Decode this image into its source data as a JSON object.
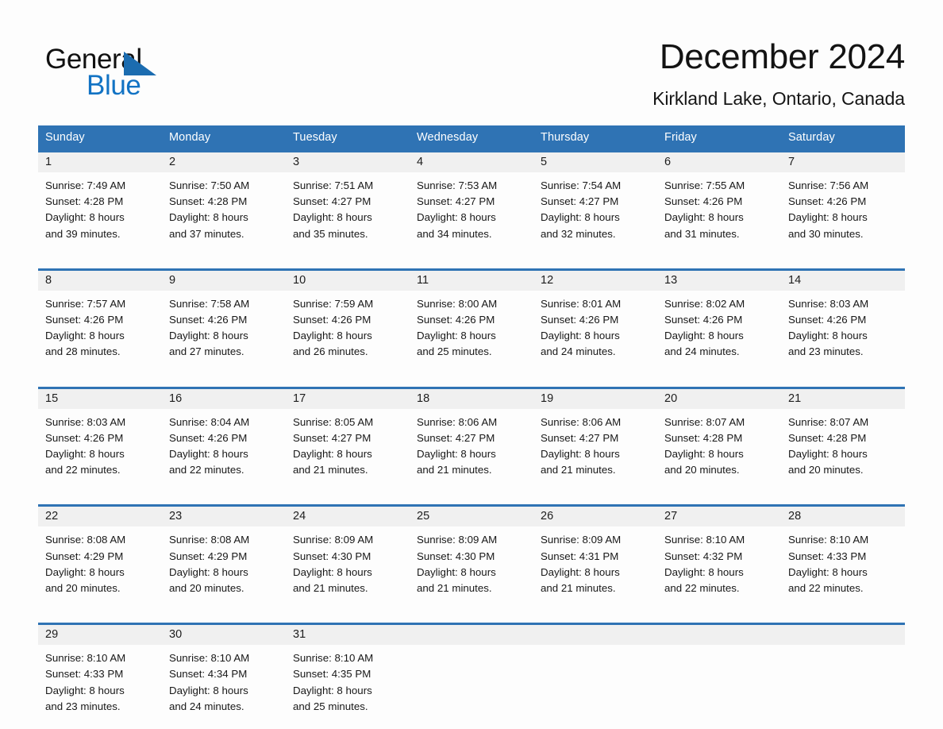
{
  "brand": {
    "name_part1": "General",
    "name_part2": "Blue",
    "triangle_color": "#1b6cb0",
    "blue_color": "#1273c4"
  },
  "header": {
    "month_title": "December 2024",
    "location": "Kirkland Lake, Ontario, Canada"
  },
  "theme": {
    "header_blue": "#2f73b4",
    "day_band_gray": "#f0f0f0",
    "page_background": "#fdfdfd"
  },
  "weekdays": [
    "Sunday",
    "Monday",
    "Tuesday",
    "Wednesday",
    "Thursday",
    "Friday",
    "Saturday"
  ],
  "weeks": [
    [
      {
        "date": "1",
        "lines": [
          "Sunrise: 7:49 AM",
          "Sunset: 4:28 PM",
          "Daylight: 8 hours",
          "and 39 minutes."
        ]
      },
      {
        "date": "2",
        "lines": [
          "Sunrise: 7:50 AM",
          "Sunset: 4:28 PM",
          "Daylight: 8 hours",
          "and 37 minutes."
        ]
      },
      {
        "date": "3",
        "lines": [
          "Sunrise: 7:51 AM",
          "Sunset: 4:27 PM",
          "Daylight: 8 hours",
          "and 35 minutes."
        ]
      },
      {
        "date": "4",
        "lines": [
          "Sunrise: 7:53 AM",
          "Sunset: 4:27 PM",
          "Daylight: 8 hours",
          "and 34 minutes."
        ]
      },
      {
        "date": "5",
        "lines": [
          "Sunrise: 7:54 AM",
          "Sunset: 4:27 PM",
          "Daylight: 8 hours",
          "and 32 minutes."
        ]
      },
      {
        "date": "6",
        "lines": [
          "Sunrise: 7:55 AM",
          "Sunset: 4:26 PM",
          "Daylight: 8 hours",
          "and 31 minutes."
        ]
      },
      {
        "date": "7",
        "lines": [
          "Sunrise: 7:56 AM",
          "Sunset: 4:26 PM",
          "Daylight: 8 hours",
          "and 30 minutes."
        ]
      }
    ],
    [
      {
        "date": "8",
        "lines": [
          "Sunrise: 7:57 AM",
          "Sunset: 4:26 PM",
          "Daylight: 8 hours",
          "and 28 minutes."
        ]
      },
      {
        "date": "9",
        "lines": [
          "Sunrise: 7:58 AM",
          "Sunset: 4:26 PM",
          "Daylight: 8 hours",
          "and 27 minutes."
        ]
      },
      {
        "date": "10",
        "lines": [
          "Sunrise: 7:59 AM",
          "Sunset: 4:26 PM",
          "Daylight: 8 hours",
          "and 26 minutes."
        ]
      },
      {
        "date": "11",
        "lines": [
          "Sunrise: 8:00 AM",
          "Sunset: 4:26 PM",
          "Daylight: 8 hours",
          "and 25 minutes."
        ]
      },
      {
        "date": "12",
        "lines": [
          "Sunrise: 8:01 AM",
          "Sunset: 4:26 PM",
          "Daylight: 8 hours",
          "and 24 minutes."
        ]
      },
      {
        "date": "13",
        "lines": [
          "Sunrise: 8:02 AM",
          "Sunset: 4:26 PM",
          "Daylight: 8 hours",
          "and 24 minutes."
        ]
      },
      {
        "date": "14",
        "lines": [
          "Sunrise: 8:03 AM",
          "Sunset: 4:26 PM",
          "Daylight: 8 hours",
          "and 23 minutes."
        ]
      }
    ],
    [
      {
        "date": "15",
        "lines": [
          "Sunrise: 8:03 AM",
          "Sunset: 4:26 PM",
          "Daylight: 8 hours",
          "and 22 minutes."
        ]
      },
      {
        "date": "16",
        "lines": [
          "Sunrise: 8:04 AM",
          "Sunset: 4:26 PM",
          "Daylight: 8 hours",
          "and 22 minutes."
        ]
      },
      {
        "date": "17",
        "lines": [
          "Sunrise: 8:05 AM",
          "Sunset: 4:27 PM",
          "Daylight: 8 hours",
          "and 21 minutes."
        ]
      },
      {
        "date": "18",
        "lines": [
          "Sunrise: 8:06 AM",
          "Sunset: 4:27 PM",
          "Daylight: 8 hours",
          "and 21 minutes."
        ]
      },
      {
        "date": "19",
        "lines": [
          "Sunrise: 8:06 AM",
          "Sunset: 4:27 PM",
          "Daylight: 8 hours",
          "and 21 minutes."
        ]
      },
      {
        "date": "20",
        "lines": [
          "Sunrise: 8:07 AM",
          "Sunset: 4:28 PM",
          "Daylight: 8 hours",
          "and 20 minutes."
        ]
      },
      {
        "date": "21",
        "lines": [
          "Sunrise: 8:07 AM",
          "Sunset: 4:28 PM",
          "Daylight: 8 hours",
          "and 20 minutes."
        ]
      }
    ],
    [
      {
        "date": "22",
        "lines": [
          "Sunrise: 8:08 AM",
          "Sunset: 4:29 PM",
          "Daylight: 8 hours",
          "and 20 minutes."
        ]
      },
      {
        "date": "23",
        "lines": [
          "Sunrise: 8:08 AM",
          "Sunset: 4:29 PM",
          "Daylight: 8 hours",
          "and 20 minutes."
        ]
      },
      {
        "date": "24",
        "lines": [
          "Sunrise: 8:09 AM",
          "Sunset: 4:30 PM",
          "Daylight: 8 hours",
          "and 21 minutes."
        ]
      },
      {
        "date": "25",
        "lines": [
          "Sunrise: 8:09 AM",
          "Sunset: 4:30 PM",
          "Daylight: 8 hours",
          "and 21 minutes."
        ]
      },
      {
        "date": "26",
        "lines": [
          "Sunrise: 8:09 AM",
          "Sunset: 4:31 PM",
          "Daylight: 8 hours",
          "and 21 minutes."
        ]
      },
      {
        "date": "27",
        "lines": [
          "Sunrise: 8:10 AM",
          "Sunset: 4:32 PM",
          "Daylight: 8 hours",
          "and 22 minutes."
        ]
      },
      {
        "date": "28",
        "lines": [
          "Sunrise: 8:10 AM",
          "Sunset: 4:33 PM",
          "Daylight: 8 hours",
          "and 22 minutes."
        ]
      }
    ],
    [
      {
        "date": "29",
        "lines": [
          "Sunrise: 8:10 AM",
          "Sunset: 4:33 PM",
          "Daylight: 8 hours",
          "and 23 minutes."
        ]
      },
      {
        "date": "30",
        "lines": [
          "Sunrise: 8:10 AM",
          "Sunset: 4:34 PM",
          "Daylight: 8 hours",
          "and 24 minutes."
        ]
      },
      {
        "date": "31",
        "lines": [
          "Sunrise: 8:10 AM",
          "Sunset: 4:35 PM",
          "Daylight: 8 hours",
          "and 25 minutes."
        ]
      },
      {
        "date": "",
        "lines": []
      },
      {
        "date": "",
        "lines": []
      },
      {
        "date": "",
        "lines": []
      },
      {
        "date": "",
        "lines": []
      }
    ]
  ]
}
